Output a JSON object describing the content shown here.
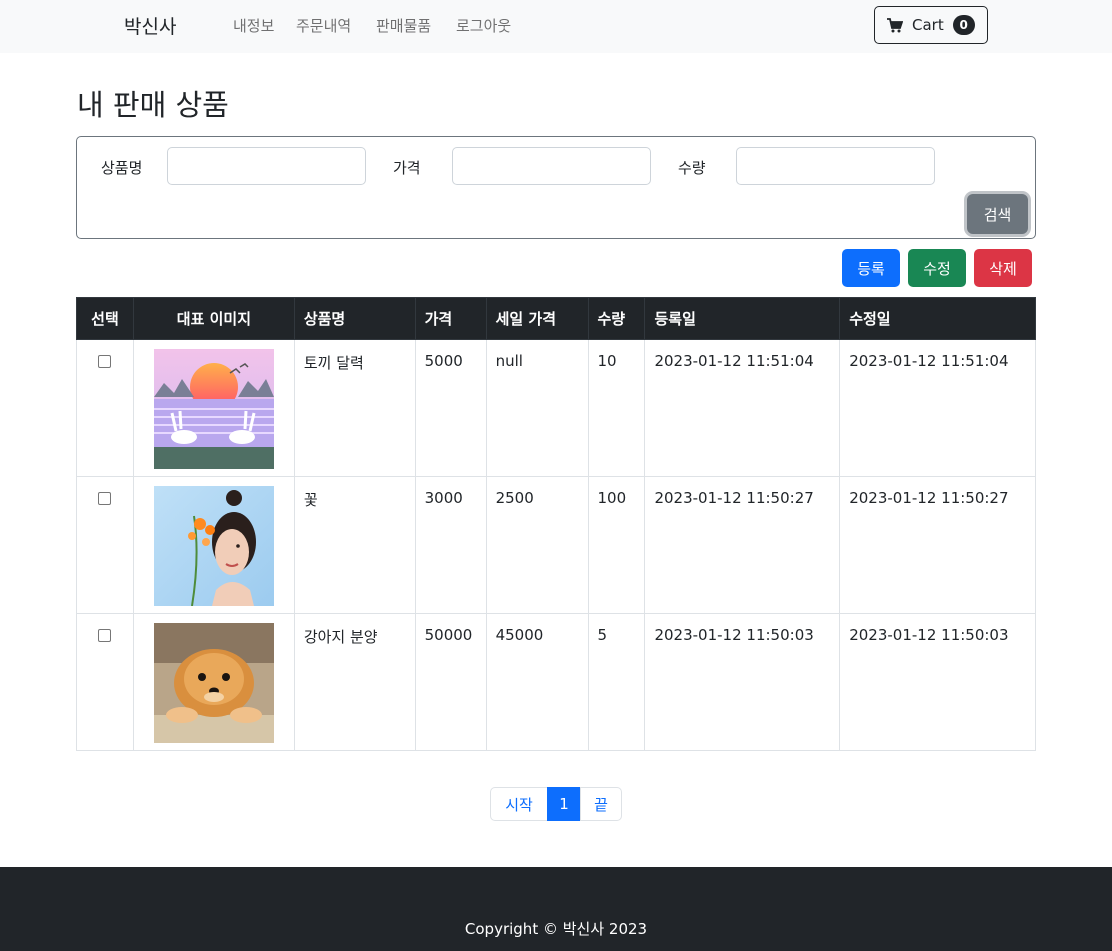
{
  "navbar": {
    "brand": "박신사",
    "links": [
      "내정보",
      "주문내역",
      "판매물품",
      "로그아웃"
    ],
    "cart_label": "Cart",
    "cart_count": "0",
    "cart_icon": "shopping-cart-icon"
  },
  "page_title": "내 판매 상품",
  "search": {
    "name_label": "상품명",
    "price_label": "가격",
    "qty_label": "수량",
    "name_value": "",
    "price_value": "",
    "qty_value": "",
    "button": "검색"
  },
  "actions": {
    "register": "등록",
    "modify": "수정",
    "delete": "삭제"
  },
  "table": {
    "headers": [
      "선택",
      "대표 이미지",
      "상품명",
      "가격",
      "세일 가격",
      "수량",
      "등록일",
      "수정일"
    ],
    "rows": [
      {
        "name": "토끼 달력",
        "price": "5000",
        "sale": "null",
        "qty": "10",
        "created": "2023-01-12 11:51:04",
        "updated": "2023-01-12 11:51:04",
        "image": "rabbit-calendar-image"
      },
      {
        "name": "꽃",
        "price": "3000",
        "sale": "2500",
        "qty": "100",
        "created": "2023-01-12 11:50:27",
        "updated": "2023-01-12 11:50:27",
        "image": "woman-with-flower-image"
      },
      {
        "name": "강아지 분양",
        "price": "50000",
        "sale": "45000",
        "qty": "5",
        "created": "2023-01-12 11:50:03",
        "updated": "2023-01-12 11:50:03",
        "image": "puppy-image"
      }
    ]
  },
  "pagination": {
    "first": "시작",
    "current": "1",
    "last": "끝"
  },
  "footer": {
    "text": "Copyright © 박신사 2023"
  },
  "colors": {
    "primary": "#0d6efd",
    "success": "#198754",
    "danger": "#dc3545",
    "secondary": "#6c757d",
    "dark": "#212529"
  }
}
